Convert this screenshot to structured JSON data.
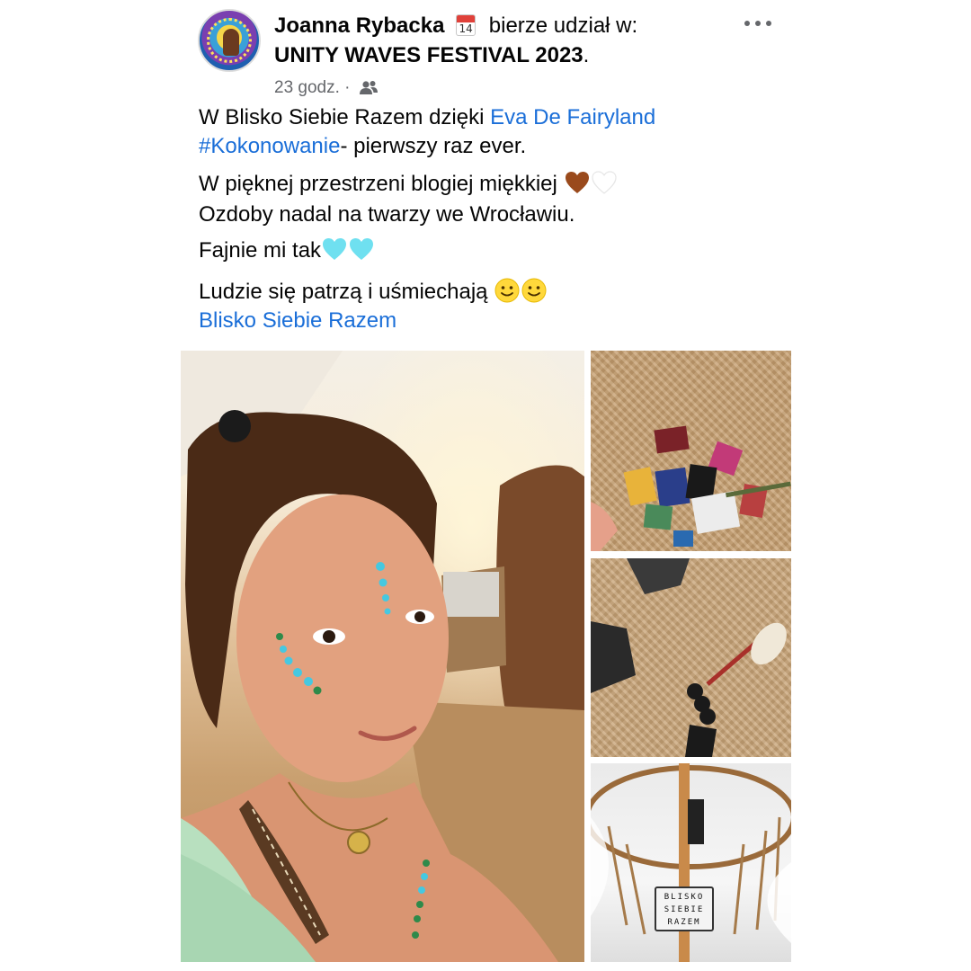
{
  "post": {
    "author": "Joanna Rybacka",
    "calendar_day": "14",
    "participation_text": "bierze udział w:",
    "event_name": "UNITY WAVES FESTIVAL 2023",
    "event_suffix": ".",
    "time_ago": "23 godz. ·",
    "audience_icon": "friends-icon",
    "more_icon": "more-options-icon"
  },
  "body": {
    "line1_prefix": "W Blisko Siebie Razem dzięki ",
    "line1_link": "Eva De Fairyland",
    "line2_hashtag": "#Kokonowanie",
    "line2_suffix": "- pierwszy raz ever.",
    "line3": "W pięknej przestrzeni blogiej miękkiej",
    "line3_emojis": [
      "brown-heart-emoji",
      "white-heart-emoji"
    ],
    "line4": "Ozdoby nadal na twarzy we Wrocławiu.",
    "line5": "Fajnie mi tak",
    "line5_emojis": [
      "light-blue-heart-emoji",
      "light-blue-heart-emoji"
    ],
    "line6": "Ludzie się patrzą i uśmiechają",
    "line6_emojis": [
      "smiling-face-emoji",
      "smiling-face-emoji"
    ],
    "line7_link": "Blisko Siebie Razem"
  },
  "photos": {
    "main": "selfie-photo",
    "top_right": "cards-on-rug-photo",
    "middle_right": "rattle-on-rug-photo",
    "bottom_right": "tent-canopy-photo",
    "sign_lines": [
      "BLISKO",
      "SIEBIE",
      "RAZEM"
    ]
  },
  "colors": {
    "link": "#1a6ed8",
    "meta": "#65676b",
    "text": "#050505"
  }
}
